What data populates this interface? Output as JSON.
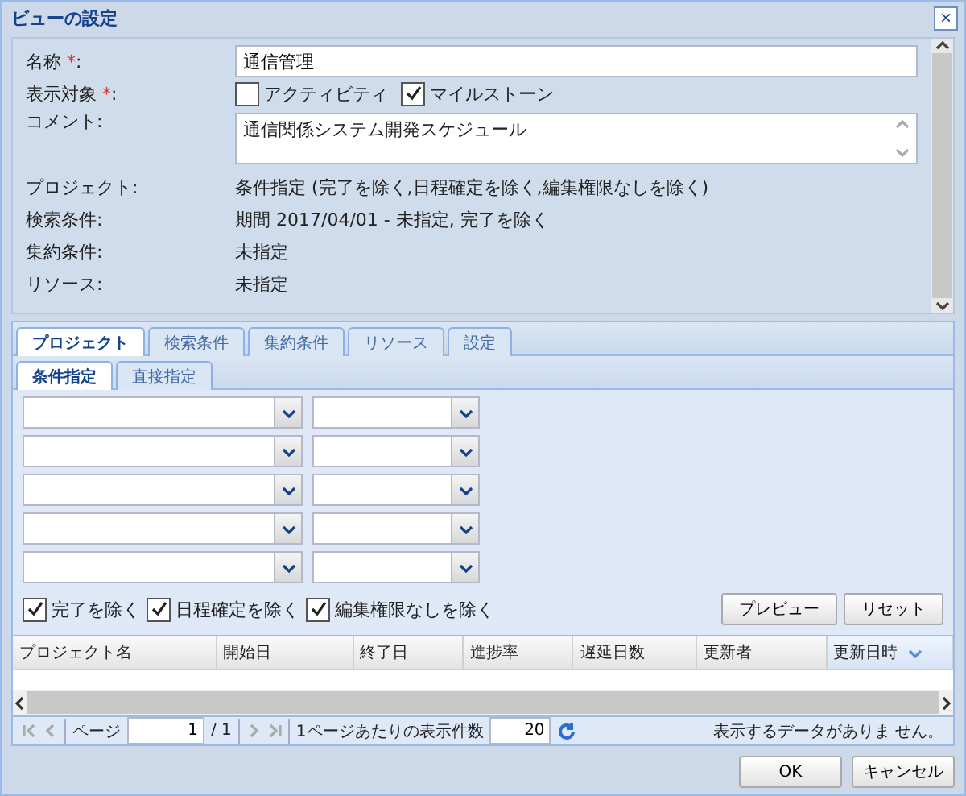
{
  "window": {
    "title": "ビューの設定",
    "close": "×"
  },
  "form": {
    "fields": [
      {
        "kind": "text",
        "label": "名称",
        "required": "*",
        "suffix": ":",
        "value": "通信管理"
      },
      {
        "kind": "checks",
        "label": "表示対象",
        "required": "*",
        "suffix": ":",
        "options": [
          {
            "label": "アクティビティ",
            "checked": false
          },
          {
            "label": "マイルストーン",
            "checked": true
          }
        ]
      },
      {
        "kind": "textarea",
        "label": "コメント:",
        "value": "通信関係システム開発スケジュール"
      },
      {
        "kind": "info",
        "label": "プロジェクト:",
        "value": "条件指定 (完了を除く,日程確定を除く,編集権限なしを除く)"
      },
      {
        "kind": "info",
        "label": "検索条件:",
        "value": "期間 2017/04/01 - 未指定, 完了を除く"
      },
      {
        "kind": "info",
        "label": "集約条件:",
        "value": "未指定"
      },
      {
        "kind": "info",
        "label": "リソース:",
        "value": "未指定"
      }
    ]
  },
  "tabs": [
    {
      "label": "プロジェクト",
      "selected": true
    },
    {
      "label": "検索条件",
      "selected": false
    },
    {
      "label": "集約条件",
      "selected": false
    },
    {
      "label": "リソース",
      "selected": false
    },
    {
      "label": "設定",
      "selected": false
    }
  ],
  "subtabs": [
    {
      "label": "条件指定",
      "selected": true
    },
    {
      "label": "直接指定",
      "selected": false
    }
  ],
  "filters": [
    {
      "kind": "combo-pair"
    },
    {
      "kind": "combo-pair"
    },
    {
      "kind": "combo-pair"
    },
    {
      "kind": "combo-pair"
    },
    {
      "kind": "combo-pair"
    }
  ],
  "excludes": [
    {
      "label": "完了を除く",
      "checked": true
    },
    {
      "label": "日程確定を除く",
      "checked": true
    },
    {
      "label": "編集権限なしを除く",
      "checked": true
    }
  ],
  "actions": [
    "プレビュー",
    "リセット"
  ],
  "grid": {
    "columns": [
      {
        "label": "プロジェクト名",
        "sorted": false
      },
      {
        "label": "開始日",
        "sorted": false
      },
      {
        "label": "終了日",
        "sorted": false
      },
      {
        "label": "進捗率",
        "sorted": false
      },
      {
        "label": "遅延日数",
        "sorted": false
      },
      {
        "label": "更新者",
        "sorted": false
      },
      {
        "label": "更新日時",
        "sorted": true
      }
    ]
  },
  "pager": {
    "page_label": "ページ",
    "page": "1",
    "total": "/ 1",
    "per_page_label": "1ページあたりの表示件数",
    "per_page": "20",
    "message": "表示するデータがありま せん。"
  },
  "buttons": [
    "OK",
    "キャンセル"
  ]
}
